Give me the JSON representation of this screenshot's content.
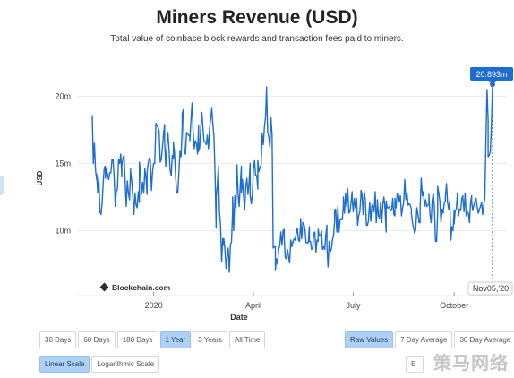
{
  "header": {
    "title": "Miners Revenue (USD)",
    "subtitle": "Total value of coinbase block rewards and transaction fees paid to miners."
  },
  "chart_data": {
    "type": "line",
    "ylabel": "USD",
    "xlabel": "Date",
    "x_ticks": [
      "2020",
      "April",
      "July",
      "October"
    ],
    "y_ticks": [
      {
        "value": 10000000,
        "label": "10m"
      },
      {
        "value": 15000000,
        "label": "15m"
      },
      {
        "value": 20000000,
        "label": "20m"
      }
    ],
    "ylim": [
      5500000,
      22500000
    ],
    "grid": true,
    "watermark": "Blockchain.com",
    "tooltip": {
      "date": "Nov05,'20",
      "value_label": "20.893m",
      "value": 20893000
    },
    "line_color": "#1f6dd1",
    "series": [
      {
        "start_date": "2019-11-06",
        "end_date": "2020-11-05",
        "values": [
          18.6,
          15.0,
          16.5,
          14.5,
          13.8,
          14.2,
          12.8,
          14.0,
          11.4,
          11.2,
          12.0,
          13.6,
          14.7,
          14.8,
          13.9,
          14.6,
          14.2,
          13.8,
          14.3,
          14.3,
          15.3,
          15.3,
          15.2,
          14.0,
          11.8,
          12.9,
          13.1,
          15.3,
          15.0,
          15.7,
          14.0,
          14.8,
          15.4,
          15.6,
          13.7,
          11.8,
          13.7,
          12.8,
          12.3,
          14.6,
          14.4,
          13.7,
          12.6,
          11.2,
          12.8,
          11.9,
          11.7,
          12.9,
          12.1,
          15.1,
          14.4,
          12.7,
          13.6,
          12.8,
          14.6,
          13.9,
          12.7,
          14.3,
          15.0,
          15.4,
          15.2,
          13.0,
          14.4,
          15.0,
          15.0,
          17.8,
          18.0,
          17.8,
          17.7,
          17.4,
          15.1,
          15.3,
          16.2,
          17.2,
          17.9,
          16.6,
          14.8,
          16.2,
          17.3,
          16.1,
          14.5,
          14.1,
          15.6,
          15.4,
          16.6,
          15.8,
          14.1,
          12.8,
          12.8,
          14.3,
          15.9,
          15.5,
          17.6,
          18.7,
          19.0,
          15.8,
          15.7,
          17.3,
          17.2,
          17.1,
          17.0,
          16.7,
          18.2,
          19.5,
          17.4,
          16.1,
          16.7,
          16.5,
          15.7,
          17.8,
          15.9,
          16.2,
          17.7,
          18.8,
          17.6,
          16.6,
          16.6,
          16.4,
          17.1,
          17.0,
          16.1,
          17.6,
          18.3,
          19.1,
          17.9,
          17.0,
          14.2,
          10.2,
          12.5,
          13.3,
          14.8,
          11.4,
          10.4,
          7.7,
          9.4,
          8.9,
          9.4,
          8.6,
          7.2,
          8.1,
          8.7,
          6.9,
          8.9,
          9.2,
          11.4,
          12.5,
          10.0,
          12.6,
          11.7,
          14.9,
          12.7,
          11.8,
          13.4,
          14.8,
          12.8,
          13.8,
          12.6,
          11.5,
          13.3,
          13.9,
          12.7,
          13.6,
          15.0,
          12.6,
          12.0,
          12.7,
          14.6,
          15.2,
          14.1,
          14.1,
          13.1,
          15.2,
          14.4,
          14.7,
          14.9,
          17.2,
          16.4,
          17.7,
          18.4,
          20.7,
          20.4,
          17.3,
          17.0,
          16.2,
          18.4,
          17.1,
          8.7,
          8.8,
          8.8,
          7.1,
          7.9,
          7.5,
          8.6,
          8.9,
          9.9,
          8.9,
          10.0,
          10.1,
          9.5,
          8.0,
          7.9,
          8.6,
          8.1,
          7.6,
          9.3,
          8.8,
          9.2,
          9.1,
          9.4,
          9.3,
          9.8,
          10.2,
          9.3,
          9.2,
          10.5,
          10.9,
          9.4,
          10.6,
          10.5,
          10.1,
          9.1,
          9.1,
          9.1,
          10.3,
          9.2,
          9.2,
          8.6,
          8.7,
          9.8,
          9.9,
          8.4,
          9.3,
          9.2,
          10.1,
          9.6,
          9.6,
          10.0,
          8.6,
          8.8,
          8.6,
          9.7,
          10.4,
          8.8,
          7.3,
          9.2,
          8.4,
          8.6,
          9.3,
          9.6,
          10.7,
          11.5,
          11.6,
          9.9,
          11.8,
          9.9,
          10.8,
          10.9,
          10.8,
          11.9,
          12.5,
          11.3,
          12.8,
          11.8,
          13.1,
          11.3,
          11.4,
          12.1,
          12.9,
          12.5,
          11.4,
          12.4,
          11.7,
          12.4,
          10.4,
          11.1,
          11.4,
          12.6,
          13.0,
          12.7,
          11.2,
          12.9,
          12.3,
          10.4,
          10.4,
          10.8,
          11.0,
          12.1,
          10.7,
          11.9,
          11.8,
          11.4,
          12.9,
          10.6,
          11.9,
          12.3,
          11.1,
          10.9,
          12.1,
          10.6,
          12.0,
          12.5,
          11.6,
          9.9,
          12.2,
          11.7,
          11.7,
          11.8,
          11.5,
          11.5,
          12.4,
          11.2,
          11.1,
          12.4,
          11.7,
          12.7,
          12.8,
          12.2,
          12.6,
          11.1,
          11.7,
          11.7,
          12.1,
          13.8,
          12.3,
          12.8,
          11.9,
          12.0,
          11.9,
          11.6,
          11.3,
          10.6,
          10.2,
          9.8,
          10.1,
          11.7,
          11.2,
          10.6,
          10.6,
          11.7,
          13.9,
          12.6,
          12.9,
          11.8,
          12.3,
          11.8,
          11.9,
          12.0,
          12.7,
          11.2,
          10.6,
          12.2,
          12.8,
          11.8,
          9.2,
          9.2,
          11.3,
          13.3,
          12.8,
          12.2,
          10.6,
          11.6,
          11.3,
          12.1,
          12.2,
          12.5,
          13.5,
          12.1,
          11.6,
          12.2,
          9.3,
          10.3,
          10.0,
          11.5,
          10.5,
          11.5,
          11.6,
          12.8,
          11.1,
          11.6,
          11.5,
          12.4,
          12.6,
          12.4,
          11.4,
          12.8,
          11.1,
          11.4,
          11.3,
          10.6,
          12.1,
          12.6,
          12.1,
          11.5,
          11.9,
          12.2,
          12.4,
          11.8,
          11.3,
          11.5,
          11.6,
          11.8,
          12.1,
          11.2,
          11.9,
          12.4,
          16.8,
          20.5,
          18.2,
          15.5,
          15.6,
          15.9,
          17.9,
          20.9
        ]
      }
    ]
  },
  "ranges": [
    "30 Days",
    "60 Days",
    "180 Days",
    "1 Year",
    "3 Years",
    "All Time"
  ],
  "ranges_active": "1 Year",
  "scales": [
    "Linear Scale",
    "Logarithmic Scale"
  ],
  "scales_active": "Linear Scale",
  "averages": [
    "Raw Values",
    "7 Day Average",
    "30 Day Average"
  ],
  "averages_active": "Raw Values",
  "partial_button": "E",
  "page_watermark": "策马网络"
}
